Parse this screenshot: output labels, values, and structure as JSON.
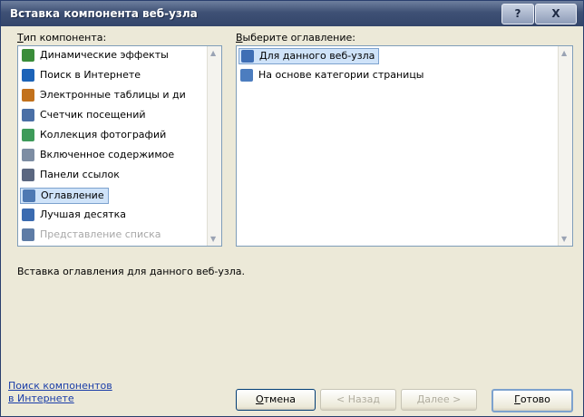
{
  "window": {
    "title": "Вставка компонента веб-узла"
  },
  "title_buttons": {
    "help": "?",
    "close": "X"
  },
  "left": {
    "label_prefix": "Т",
    "label_rest": "ип компонента:",
    "items": [
      {
        "label": "Динамические эффекты",
        "icon": "effects-icon",
        "color": "#3a8d3a",
        "selected": false,
        "disabled": false
      },
      {
        "label": "Поиск в Интернете",
        "icon": "globe-search-icon",
        "color": "#1c63b8",
        "selected": false,
        "disabled": false
      },
      {
        "label": "Электронные таблицы и ди",
        "icon": "spreadsheet-chart-icon",
        "color": "#c2711c",
        "selected": false,
        "disabled": false
      },
      {
        "label": "Счетчик посещений",
        "icon": "counter-icon",
        "color": "#4a6fa6",
        "selected": false,
        "disabled": false
      },
      {
        "label": "Коллекция фотографий",
        "icon": "photo-gallery-icon",
        "color": "#3e9b5a",
        "selected": false,
        "disabled": false
      },
      {
        "label": "Включенное содержимое",
        "icon": "included-content-icon",
        "color": "#7d8da3",
        "selected": false,
        "disabled": false
      },
      {
        "label": "Панели ссылок",
        "icon": "link-bar-icon",
        "color": "#5b6780",
        "selected": false,
        "disabled": false
      },
      {
        "label": "Оглавление",
        "icon": "table-of-contents-icon",
        "color": "#4e79b3",
        "selected": true,
        "disabled": false
      },
      {
        "label": "Лучшая десятка",
        "icon": "top-ten-icon",
        "color": "#3b6bb0",
        "selected": false,
        "disabled": false
      },
      {
        "label": "Представление списка",
        "icon": "list-view-icon",
        "color": "#5e7ca6",
        "selected": false,
        "disabled": true
      }
    ]
  },
  "right": {
    "label_prefix": "В",
    "label_rest": "ыберите оглавление:",
    "items": [
      {
        "label": "Для данного веб-узла",
        "icon": "site-toc-icon",
        "color": "#3f6fb5",
        "selected": true
      },
      {
        "label": "На основе категории страницы",
        "icon": "category-toc-icon",
        "color": "#4c7dbf",
        "selected": false
      }
    ]
  },
  "description": "Вставка оглавления для данного веб-узла.",
  "link": {
    "line1": "Поиск компонентов",
    "line2": "в Интернете"
  },
  "buttons": {
    "cancel_prefix": "О",
    "cancel_rest": "тмена",
    "back": "< Назад",
    "next": "Далее >",
    "finish_prefix": "Г",
    "finish_rest": "отово"
  }
}
